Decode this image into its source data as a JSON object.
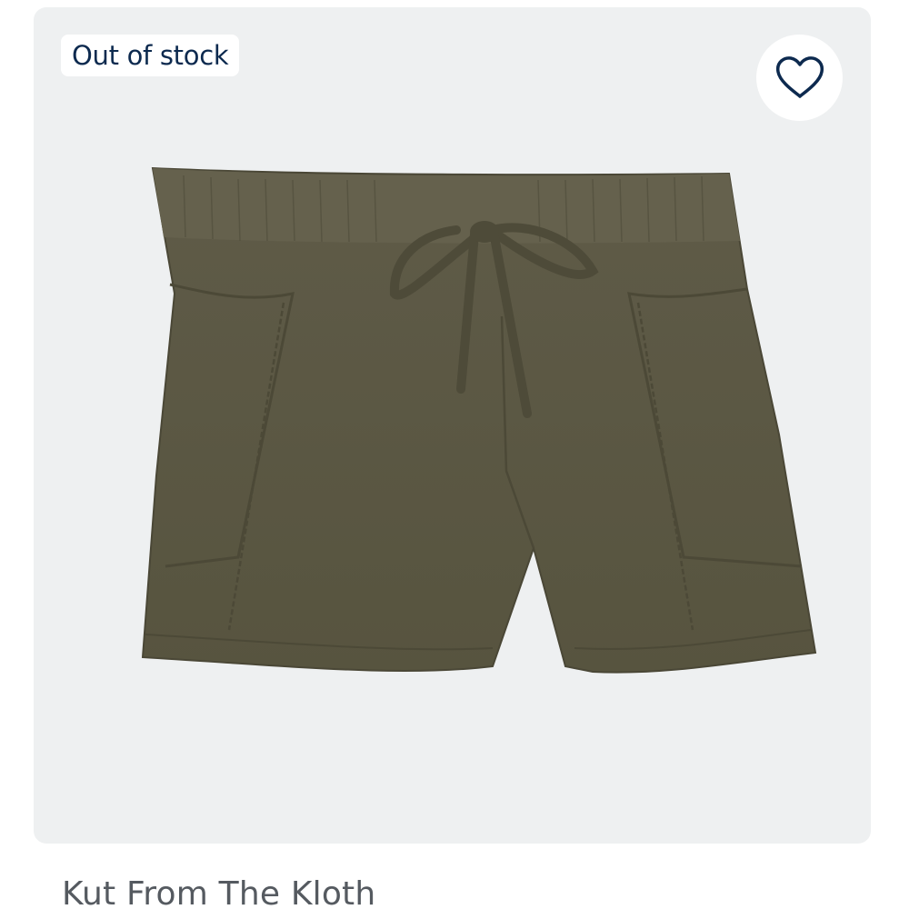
{
  "product": {
    "stock_badge": "Out of stock",
    "brand": "Kut From The Kloth",
    "image_alt": "Olive drawstring shorts"
  },
  "icons": {
    "favorite": "heart-outline-icon"
  },
  "colors": {
    "card_background": "#eef0f1",
    "badge_text": "#0d2a4f",
    "product_color": "#5b5845",
    "brand_text": "#555a60"
  }
}
